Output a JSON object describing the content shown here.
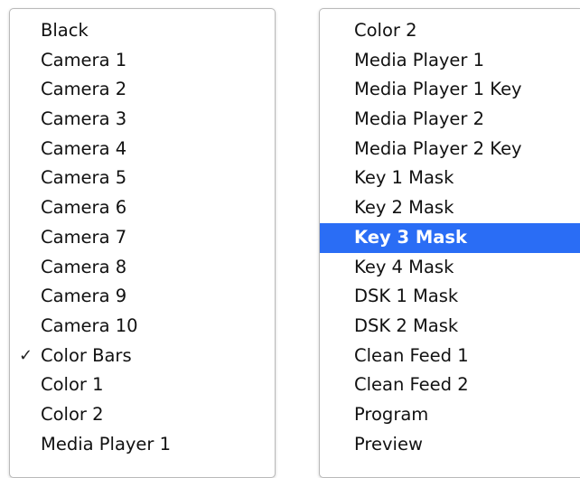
{
  "left_menu": {
    "items": [
      {
        "label": "Black"
      },
      {
        "label": "Camera 1"
      },
      {
        "label": "Camera 2"
      },
      {
        "label": "Camera 3"
      },
      {
        "label": "Camera 4"
      },
      {
        "label": "Camera 5"
      },
      {
        "label": "Camera 6"
      },
      {
        "label": "Camera 7"
      },
      {
        "label": "Camera 8"
      },
      {
        "label": "Camera 9"
      },
      {
        "label": "Camera 10"
      },
      {
        "label": "Color Bars",
        "checked": true,
        "check_mark": "✓"
      },
      {
        "label": "Color 1"
      },
      {
        "label": "Color 2"
      },
      {
        "label": "Media Player 1"
      }
    ]
  },
  "right_menu": {
    "items": [
      {
        "label": "Color 2"
      },
      {
        "label": "Media Player 1"
      },
      {
        "label": "Media Player 1 Key"
      },
      {
        "label": "Media Player 2"
      },
      {
        "label": "Media Player 2 Key"
      },
      {
        "label": "Key 1 Mask"
      },
      {
        "label": "Key 2 Mask"
      },
      {
        "label": "Key 3 Mask",
        "selected": true
      },
      {
        "label": "Key 4 Mask"
      },
      {
        "label": "DSK 1 Mask"
      },
      {
        "label": "DSK 2 Mask"
      },
      {
        "label": "Clean Feed 1"
      },
      {
        "label": "Clean Feed 2"
      },
      {
        "label": "Program"
      },
      {
        "label": "Preview"
      }
    ]
  },
  "colors": {
    "highlight": "#2a6df5",
    "text": "#111111",
    "border": "#b9b9b9"
  }
}
